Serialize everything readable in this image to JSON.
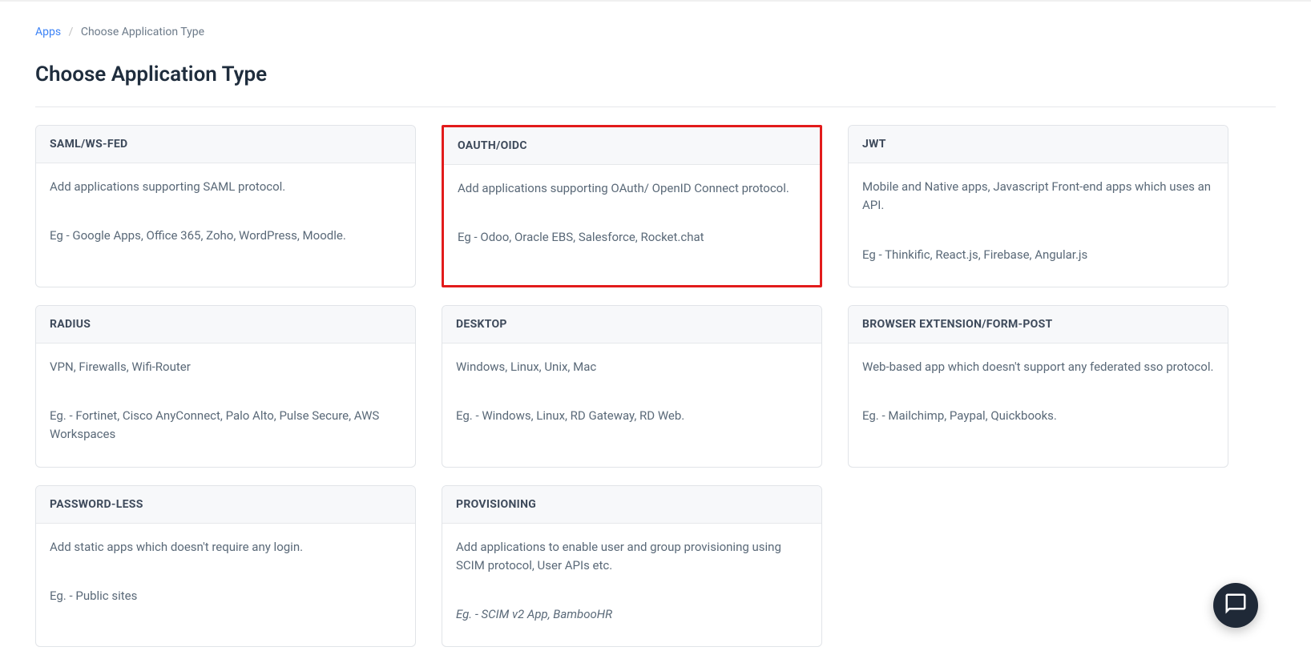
{
  "breadcrumb": {
    "link_text": "Apps",
    "separator": "/",
    "current": "Choose Application Type"
  },
  "page_title": "Choose Application Type",
  "cards": [
    {
      "id": "saml",
      "title": "SAML/WS-FED",
      "desc": "Add applications supporting SAML protocol.",
      "eg": "Eg - Google Apps, Office 365, Zoho, WordPress, Moodle.",
      "highlighted": false,
      "eg_italic": false
    },
    {
      "id": "oauth",
      "title": "OAUTH/OIDC",
      "desc": "Add applications supporting OAuth/ OpenID Connect protocol.",
      "eg": "Eg - Odoo, Oracle EBS, Salesforce, Rocket.chat",
      "highlighted": true,
      "eg_italic": false
    },
    {
      "id": "jwt",
      "title": "JWT",
      "desc": "Mobile and Native apps, Javascript Front-end apps which uses an API.",
      "eg": "Eg - Thinkific, React.js, Firebase, Angular.js",
      "highlighted": false,
      "eg_italic": false
    },
    {
      "id": "radius",
      "title": "RADIUS",
      "desc": "VPN, Firewalls, Wifi-Router",
      "eg": "Eg. - Fortinet, Cisco AnyConnect, Palo Alto, Pulse Secure, AWS Workspaces",
      "highlighted": false,
      "eg_italic": false
    },
    {
      "id": "desktop",
      "title": "DESKTOP",
      "desc": "Windows, Linux, Unix, Mac",
      "eg": "Eg. - Windows, Linux, RD Gateway, RD Web.",
      "highlighted": false,
      "eg_italic": false
    },
    {
      "id": "browser-extension",
      "title": "BROWSER EXTENSION/FORM-POST",
      "desc": "Web-based app which doesn't support any federated sso protocol.",
      "eg": "Eg. - Mailchimp, Paypal, Quickbooks.",
      "highlighted": false,
      "eg_italic": false
    },
    {
      "id": "passwordless",
      "title": "PASSWORD-LESS",
      "desc": "Add static apps which doesn't require any login.",
      "eg": "Eg. - Public sites",
      "highlighted": false,
      "eg_italic": false
    },
    {
      "id": "provisioning",
      "title": "PROVISIONING",
      "desc": "Add applications to enable user and group provisioning using SCIM protocol, User APIs etc.",
      "eg": "Eg. - SCIM v2 App, BambooHR",
      "highlighted": false,
      "eg_italic": true
    }
  ]
}
